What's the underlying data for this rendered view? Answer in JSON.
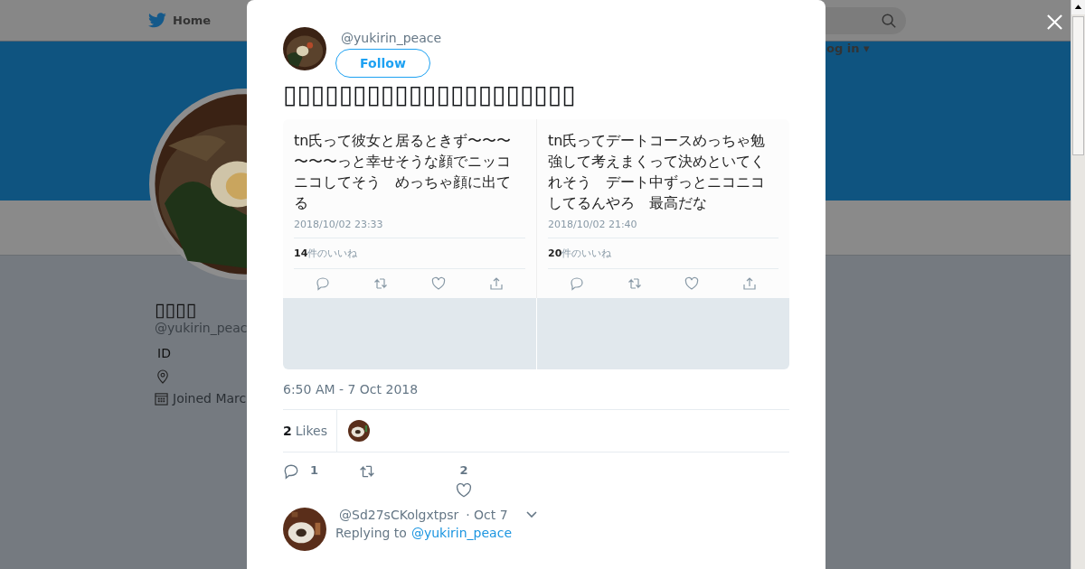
{
  "backdrop": {
    "nav_home": "Home",
    "login": "og in ▾",
    "profile": {
      "name": "▯▯▯▯",
      "handle": "@yukirin_peac",
      "id_label": "ID",
      "joined": "Joined Marc"
    }
  },
  "tweet": {
    "handle": "@yukirin_peace",
    "follow": "Follow",
    "text": "▯▯▯▯▯▯▯▯▯▯▯▯▯▯▯▯▯▯▯▯▯",
    "embedded": [
      {
        "text": "tn氏って彼女と居るときず〜〜〜〜〜〜っと幸せそうな顔でニッコニコしてそう　めっちゃ顔に出てる",
        "date": "2018/10/02 23:33",
        "likes": "**14**件のいいね"
      },
      {
        "text": "tn氏ってデートコースめっちゃ勉強して考えまくって決めといてくれそう　デート中ずっとニコニコしてるんやろ　最高だな",
        "date": "2018/10/02 21:40",
        "likes": "**20**件のいいね"
      }
    ],
    "timestamp": "6:50 AM - 7 Oct 2018",
    "likes_count": "2",
    "likes_label": "Likes",
    "reply_count": "1",
    "like_count": "2"
  },
  "reply": {
    "handle": "@Sd27sCKolgxtpsr",
    "time": "· Oct 7",
    "replying_label": "Replying to",
    "replying_to": "@yukirin_peace"
  }
}
